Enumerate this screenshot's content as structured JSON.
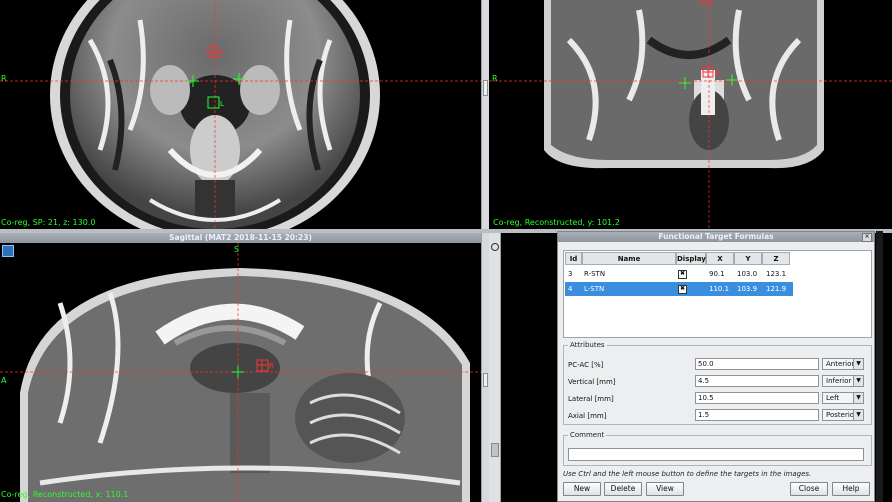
{
  "top_left_view": {
    "label": "Co-reg, SP: 21, z: 130.0",
    "side_marker": "R",
    "target_labels": [
      "R",
      "L"
    ]
  },
  "top_right_view": {
    "label": "Co-reg, Reconstructed, y: 101.2",
    "side_marker": "R",
    "target_label": "R"
  },
  "sagittal_view": {
    "title": "Sagittal (MAT2 2018-11-15 20:23)",
    "label": "Co-reg, Reconstructed, x: 110.1",
    "top_marker": "S",
    "side_marker": "A",
    "target_label": "R"
  },
  "dialog": {
    "title": "Functional Target Formulas",
    "close_glyph": "×",
    "columns": [
      "Id",
      "Name",
      "Display",
      "X",
      "Y",
      "Z"
    ],
    "rows": [
      {
        "id": "3",
        "name": "R-STN",
        "display": "✖",
        "x": "90.1",
        "y": "103.0",
        "z": "123.1",
        "selected": false
      },
      {
        "id": "4",
        "name": "L-STN",
        "display": "✖",
        "x": "110.1",
        "y": "103.9",
        "z": "121.9",
        "selected": true
      }
    ],
    "attributes": {
      "legend": "Attributes",
      "fields": [
        {
          "label": "PC-AC [%]",
          "value": "50.0",
          "option": "Anterior"
        },
        {
          "label": "Vertical [mm]",
          "value": "4.5",
          "option": "Inferior"
        },
        {
          "label": "Lateral [mm]",
          "value": "10.5",
          "option": "Left"
        },
        {
          "label": "Axial [mm]",
          "value": "1.5",
          "option": "Posterior"
        }
      ]
    },
    "comment": {
      "legend": "Comment",
      "value": ""
    },
    "hint": "Use Ctrl and the left mouse button to define the targets in the images.",
    "buttons": {
      "new": "New",
      "delete": "Delete",
      "view": "View",
      "close": "Close",
      "help": "Help"
    }
  },
  "colors": {
    "overlay_green": "#2aff2a",
    "target_red": "#ff3333",
    "selection": "#3a8ee0"
  }
}
